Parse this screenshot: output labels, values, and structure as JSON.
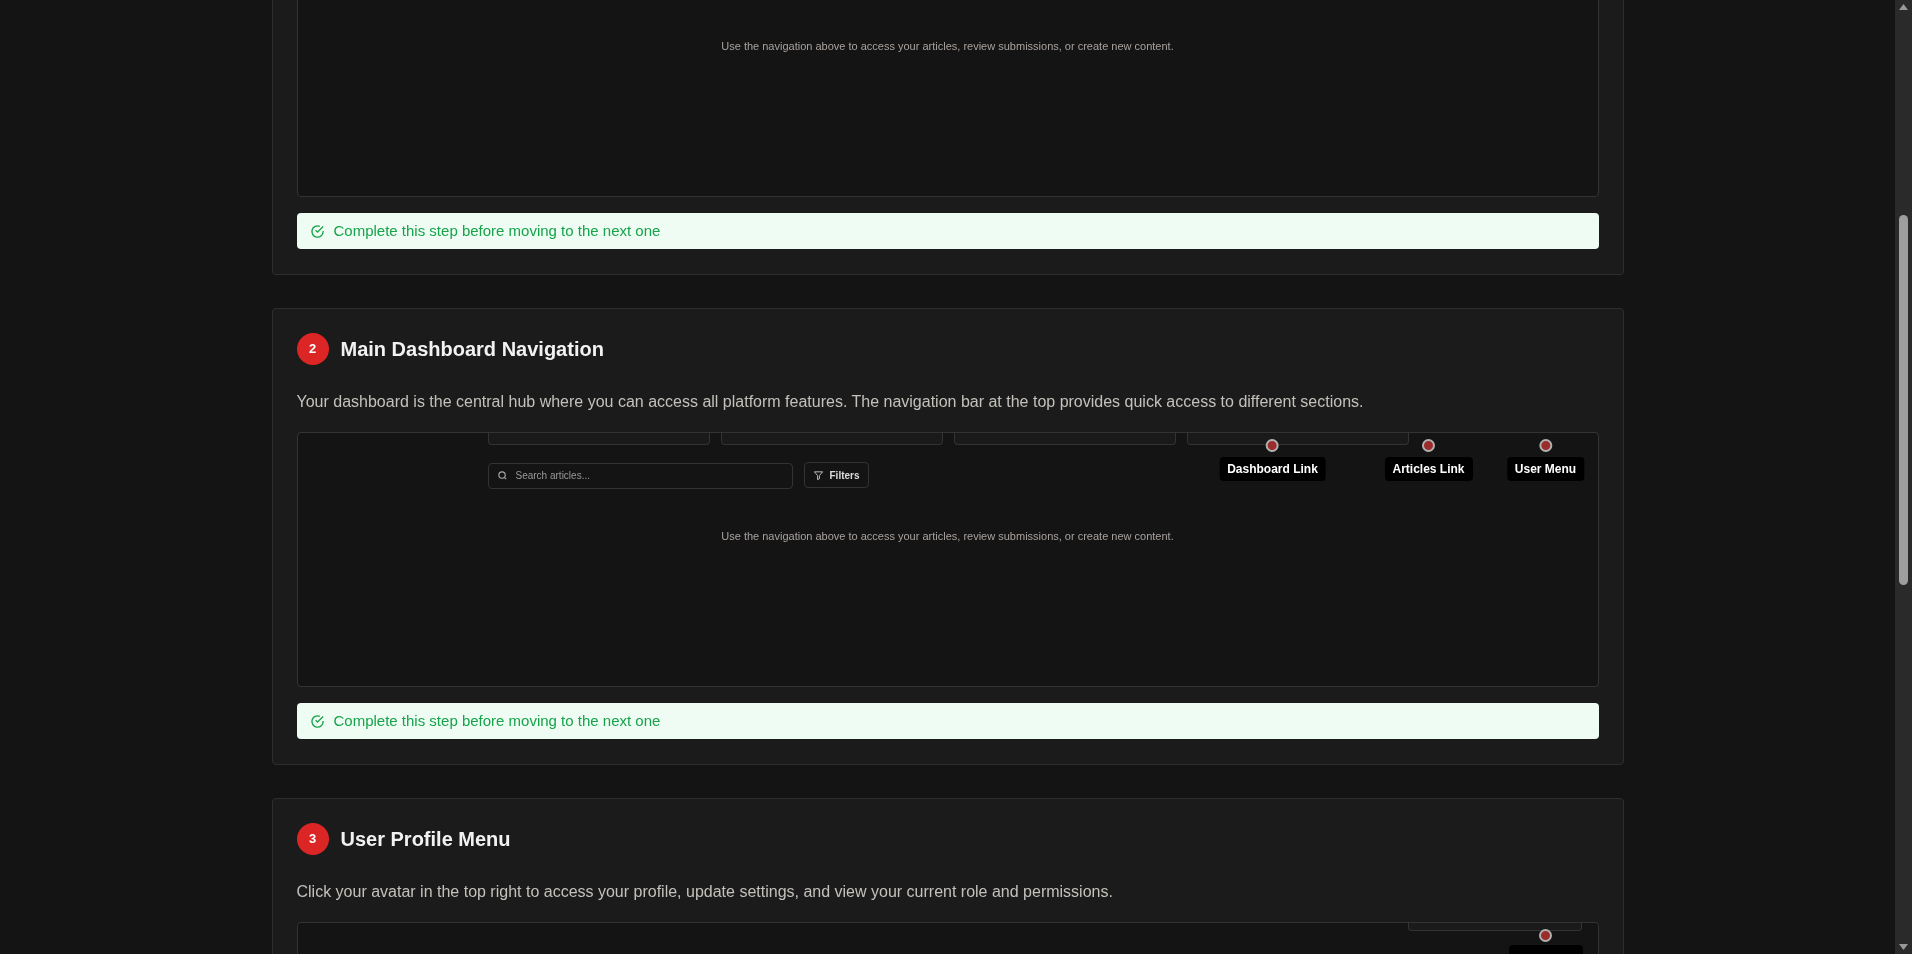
{
  "steps": [
    {
      "preview": {
        "caption": "Use the navigation above to access your articles, review submissions, or create new content."
      },
      "notice": "Complete this step before moving to the next one"
    },
    {
      "number": "2",
      "title": "Main Dashboard Navigation",
      "description": "Your dashboard is the central hub where you can access all platform features. The navigation bar at the top provides quick access to different sections.",
      "preview": {
        "search_placeholder": "Search articles...",
        "filter_button": "Filters",
        "hotspots": [
          {
            "kind": "marker",
            "label": "Dashboard Link"
          },
          {
            "kind": "marker",
            "label": "Articles Link"
          },
          {
            "kind": "marker",
            "label": "User Menu"
          }
        ],
        "caption": "Use the navigation above to access your articles, review submissions, or create new content."
      },
      "notice": "Complete this step before moving to the next one"
    },
    {
      "number": "3",
      "title": "User Profile Menu",
      "description": "Click your avatar in the top right to access your profile, update settings, and view your current role and permissions.",
      "preview": {
        "hotspots": [
          {
            "kind": "marker"
          }
        ]
      }
    }
  ]
}
